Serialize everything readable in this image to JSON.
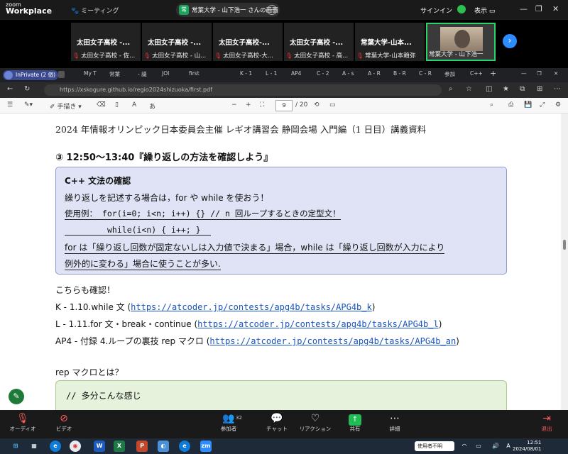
{
  "zoom_top": {
    "logo_top": "zoom",
    "logo_bottom": "Workplace",
    "meeting_label": "ミーティング",
    "share_title": "常葉大学 - 山下浩一 さんの画面",
    "share_badge": "常",
    "signin": "サインイン",
    "view": "表示"
  },
  "participants": [
    {
      "name": "太田女子高校 -...",
      "label": "太田女子高校 - 佐..."
    },
    {
      "name": "太田女子高校 -...",
      "label": "太田女子高校 - 山..."
    },
    {
      "name": "太田女子高校-...",
      "label": "太田女子高校-大..."
    },
    {
      "name": "太田女子高校 -...",
      "label": "太田女子高校 - 高..."
    },
    {
      "name": "常葉大学-山本...",
      "label": "常葉大学-山本賴弥"
    },
    {
      "name": "",
      "label": "常葉大学 - 山下浩一"
    }
  ],
  "browser": {
    "inprivate": "InPrivate (2 個)",
    "tabs": [
      "My T",
      "常葉",
      "- 議",
      "JOI",
      "first",
      "K - 1",
      "L - 1",
      "AP4",
      "C - 2",
      "A - s",
      "A - R",
      "B - R",
      "C - R",
      "参加",
      "C++"
    ],
    "url": "https://xskogure.github.io/regio2024shizuoka/first.pdf"
  },
  "pdf_toolbar": {
    "draw_label": "手描き",
    "page_current": "9",
    "page_total": "/ 20",
    "aa": "あ"
  },
  "doc": {
    "header": "2024 年情報オリンピック日本委員会主催 レギオ講習会 静岡会場 入門編（1 日目）講義資料",
    "section": "③  12:50～13:40『繰り返しの方法を確認しよう』",
    "box_title": "C++ 文法の確認",
    "box_line1": "繰り返しを記述する場合は，for や while を使おう！",
    "box_line2": "使用例： for(i=0; i<n; i++) {} // n 回ループするときの定型文！",
    "box_line3": "while(i<n) { i++; }",
    "box_line4": "for は「繰り返し回数が固定ないしは入力値で決まる」場合，while は「繰り返し回数が入力により",
    "box_line5": "例外的に変わる」場合に使うことが多い.",
    "check_label": "こちらも確認！",
    "link_k_label": "K - 1.10.while 文 (",
    "link_k_url": "https://atcoder.jp/contests/apg4b/tasks/APG4b_k",
    "link_l_label": "L - 1.11.for 文・break・continue (",
    "link_l_url": "https://atcoder.jp/contests/apg4b/tasks/APG4b_l",
    "link_ap4_label": "AP4 - 付録 4.ループの裏技 rep マクロ (",
    "link_ap4_url": "https://atcoder.jp/contests/apg4b/tasks/APG4b_an",
    "close_paren": ")",
    "rep_question": "rep マクロとは？",
    "code_comment": "// 多分こんな感じ"
  },
  "zoom_bottom": {
    "audio": "オーディオ",
    "video": "ビデオ",
    "participants": "参加者",
    "participants_count": "32",
    "chat": "チャット",
    "reactions": "リアクション",
    "share": "共有",
    "more": "詳細",
    "exit": "退出"
  },
  "taskbar": {
    "user_badge": "使用者不明",
    "ime": "A",
    "time": "12:51",
    "date": "2024/08/01"
  }
}
